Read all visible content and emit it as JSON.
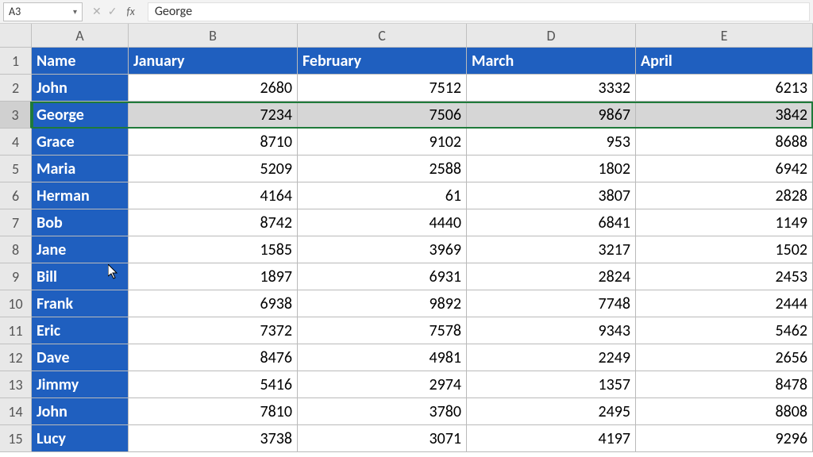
{
  "namebox": {
    "value": "A3"
  },
  "formula": {
    "fx": "fx",
    "value": "George"
  },
  "colHeaders": [
    "A",
    "B",
    "C",
    "D",
    "E"
  ],
  "rowHeaders": [
    "1",
    "2",
    "3",
    "4",
    "5",
    "6",
    "7",
    "8",
    "9",
    "10",
    "11",
    "12",
    "13",
    "14",
    "15"
  ],
  "selectedRow": 3,
  "table": {
    "headers": [
      "Name",
      "January",
      "February",
      "March",
      "April"
    ],
    "rows": [
      {
        "name": "John",
        "jan": "2680",
        "feb": "7512",
        "mar": "3332",
        "apr": "6213"
      },
      {
        "name": "George",
        "jan": "7234",
        "feb": "7506",
        "mar": "9867",
        "apr": "3842"
      },
      {
        "name": "Grace",
        "jan": "8710",
        "feb": "9102",
        "mar": "953",
        "apr": "8688"
      },
      {
        "name": "Maria",
        "jan": "5209",
        "feb": "2588",
        "mar": "1802",
        "apr": "6942"
      },
      {
        "name": "Herman",
        "jan": "4164",
        "feb": "61",
        "mar": "3807",
        "apr": "2828"
      },
      {
        "name": "Bob",
        "jan": "8742",
        "feb": "4440",
        "mar": "6841",
        "apr": "1149"
      },
      {
        "name": "Jane",
        "jan": "1585",
        "feb": "3969",
        "mar": "3217",
        "apr": "1502"
      },
      {
        "name": "Bill",
        "jan": "1897",
        "feb": "6931",
        "mar": "2824",
        "apr": "2453"
      },
      {
        "name": "Frank",
        "jan": "6938",
        "feb": "9892",
        "mar": "7748",
        "apr": "2444"
      },
      {
        "name": "Eric",
        "jan": "7372",
        "feb": "7578",
        "mar": "9343",
        "apr": "5462"
      },
      {
        "name": "Dave",
        "jan": "8476",
        "feb": "4981",
        "mar": "2249",
        "apr": "2656"
      },
      {
        "name": "Jimmy",
        "jan": "5416",
        "feb": "2974",
        "mar": "1357",
        "apr": "8478"
      },
      {
        "name": "John",
        "jan": "7810",
        "feb": "3780",
        "mar": "2495",
        "apr": "8808"
      },
      {
        "name": "Lucy",
        "jan": "3738",
        "feb": "3071",
        "mar": "4197",
        "apr": "9296"
      }
    ]
  },
  "chart_data": {
    "type": "table",
    "title": "",
    "columns": [
      "Name",
      "January",
      "February",
      "March",
      "April"
    ],
    "rows": [
      [
        "John",
        2680,
        7512,
        3332,
        6213
      ],
      [
        "George",
        7234,
        7506,
        9867,
        3842
      ],
      [
        "Grace",
        8710,
        9102,
        953,
        8688
      ],
      [
        "Maria",
        5209,
        2588,
        1802,
        6942
      ],
      [
        "Herman",
        4164,
        61,
        3807,
        2828
      ],
      [
        "Bob",
        8742,
        4440,
        6841,
        1149
      ],
      [
        "Jane",
        1585,
        3969,
        3217,
        1502
      ],
      [
        "Bill",
        1897,
        6931,
        2824,
        2453
      ],
      [
        "Frank",
        6938,
        9892,
        7748,
        2444
      ],
      [
        "Eric",
        7372,
        7578,
        9343,
        5462
      ],
      [
        "Dave",
        8476,
        4981,
        2249,
        2656
      ],
      [
        "Jimmy",
        5416,
        2974,
        1357,
        8478
      ],
      [
        "John",
        7810,
        3780,
        2495,
        8808
      ],
      [
        "Lucy",
        3738,
        3071,
        4197,
        9296
      ]
    ]
  }
}
